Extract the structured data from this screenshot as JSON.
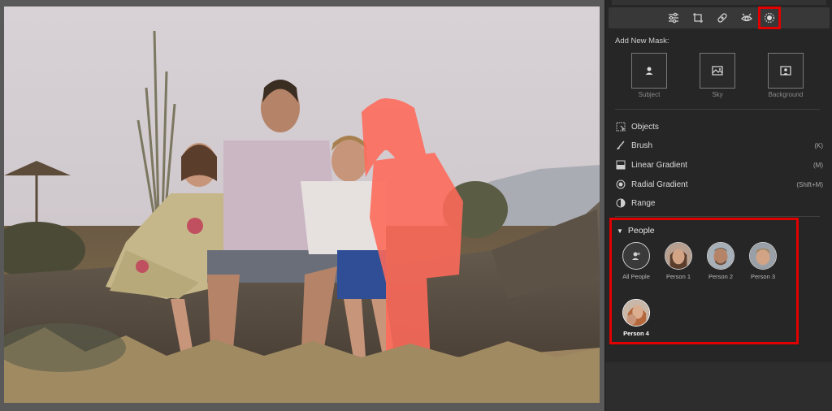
{
  "toolbar": {
    "tools": [
      {
        "icon": "sliders-icon"
      },
      {
        "icon": "crop-rotate-icon"
      },
      {
        "icon": "healing-bandage-icon"
      },
      {
        "icon": "red-eye-icon"
      },
      {
        "icon": "masking-icon",
        "active": true
      }
    ]
  },
  "add_mask": {
    "title": "Add New Mask:",
    "tiles": [
      {
        "label": "Subject",
        "icon": "subject-icon"
      },
      {
        "label": "Sky",
        "icon": "sky-icon"
      },
      {
        "label": "Background",
        "icon": "background-icon"
      }
    ]
  },
  "mask_tools": [
    {
      "label": "Objects",
      "shortcut": "",
      "icon": "objects-icon"
    },
    {
      "label": "Brush",
      "shortcut": "(K)",
      "icon": "brush-icon"
    },
    {
      "label": "Linear Gradient",
      "shortcut": "(M)",
      "icon": "linear-gradient-icon"
    },
    {
      "label": "Radial Gradient",
      "shortcut": "(Shift+M)",
      "icon": "radial-gradient-icon"
    },
    {
      "label": "Range",
      "shortcut": "",
      "icon": "range-icon"
    }
  ],
  "people": {
    "title": "People",
    "items": [
      {
        "label": "All People"
      },
      {
        "label": "Person 1"
      },
      {
        "label": "Person 2"
      },
      {
        "label": "Person 3"
      },
      {
        "label": "Person 4",
        "selected": true
      }
    ]
  },
  "colors": {
    "highlight": "#e00000",
    "panel_bg": "#262626",
    "mask_overlay": "#ff6a5a"
  }
}
